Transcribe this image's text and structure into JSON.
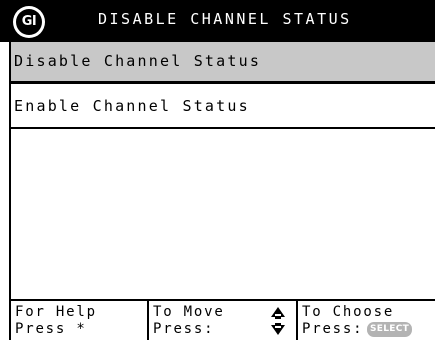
{
  "header": {
    "logo_text": "GI",
    "title": "DISABLE CHANNEL STATUS"
  },
  "menu": {
    "items": [
      {
        "label": "Disable Channel Status",
        "selected": true
      },
      {
        "label": "Enable Channel Status",
        "selected": false
      }
    ]
  },
  "footer": {
    "help": {
      "line1": "For Help",
      "line2": "Press *"
    },
    "move": {
      "line1": "To Move",
      "line2": "Press:",
      "icon": "up-down-arrows-icon"
    },
    "choose": {
      "line1": "To Choose",
      "line2": "Press:",
      "key_label": "SELECT"
    }
  },
  "colors": {
    "title_bar": "#000000",
    "selected_row": "#c8c8c8",
    "select_key": "#b3b3b3"
  }
}
